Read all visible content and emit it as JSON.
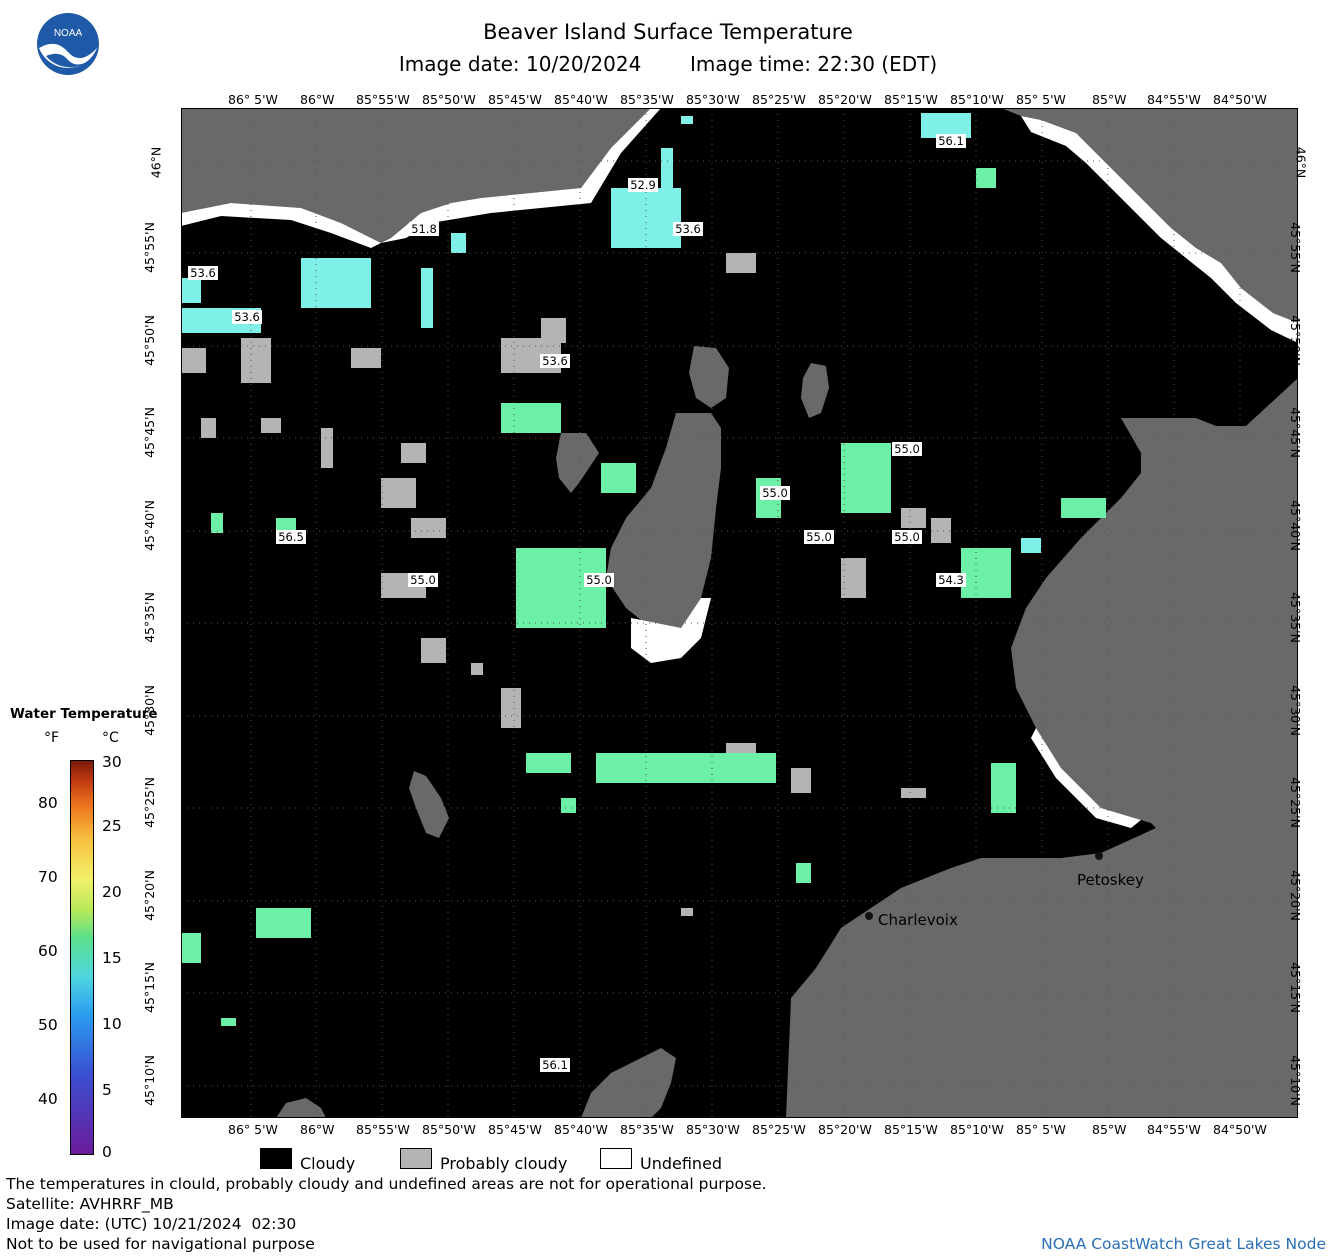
{
  "header": {
    "title": "Beaver Island Surface Temperature",
    "image_date": "Image date: 10/20/2024",
    "image_time": "Image time: 22:30 (EDT)"
  },
  "logo": {
    "text": "NOAA",
    "icon": "noaa-logo"
  },
  "axes": {
    "lon_labels": [
      "86° 5'W",
      "86°W",
      "85°55'W",
      "85°50'W",
      "85°45'W",
      "85°40'W",
      "85°35'W",
      "85°30'W",
      "85°25'W",
      "85°20'W",
      "85°15'W",
      "85°10'W",
      "85° 5'W",
      "85°W",
      "84°55'W",
      "84°50'W"
    ],
    "lat_labels": [
      "46°N",
      "45°55'N",
      "45°50'N",
      "45°45'N",
      "45°40'N",
      "45°35'N",
      "45°30'N",
      "45°25'N",
      "45°20'N",
      "45°15'N",
      "45°10'N"
    ]
  },
  "map": {
    "colors": {
      "cloud": "#000000",
      "land": "#696969",
      "probably_cloudy": "#b4b4b4",
      "undefined": "#ffffff",
      "water_cool": "#7ff0e8",
      "water_mid": "#6cf0a8"
    },
    "temp_labels": [
      "56.1",
      "52.9",
      "51.8",
      "53.6",
      "53.6",
      "53.6",
      "53.6",
      "55.0",
      "55.0",
      "56.5",
      "55.0",
      "55.0",
      "55.0",
      "55.0",
      "54.3",
      "56.1"
    ],
    "places": [
      "Petoskey",
      "Charlevoix"
    ]
  },
  "scale": {
    "title": "Water Temperature",
    "unit_f": "°F",
    "unit_c": "°C",
    "f_values": [
      "80",
      "70",
      "60",
      "50",
      "40"
    ],
    "c_values": [
      "30",
      "25",
      "20",
      "15",
      "10",
      "5",
      "0"
    ]
  },
  "legend": {
    "cloudy": "Cloudy",
    "probably_cloudy": "Probably cloudy",
    "undefined": "Undefined"
  },
  "footer": {
    "disclaimer": "The temperatures in clould, probably cloudy and undefined areas are not for operational purpose.",
    "satellite": "Satellite: AVHRRF_MB",
    "utc_date": "Image date: (UTC) 10/21/2024  02:30",
    "navigation": "Not to be used for navigational purpose",
    "credit": "NOAA CoastWatch Great Lakes Node"
  }
}
